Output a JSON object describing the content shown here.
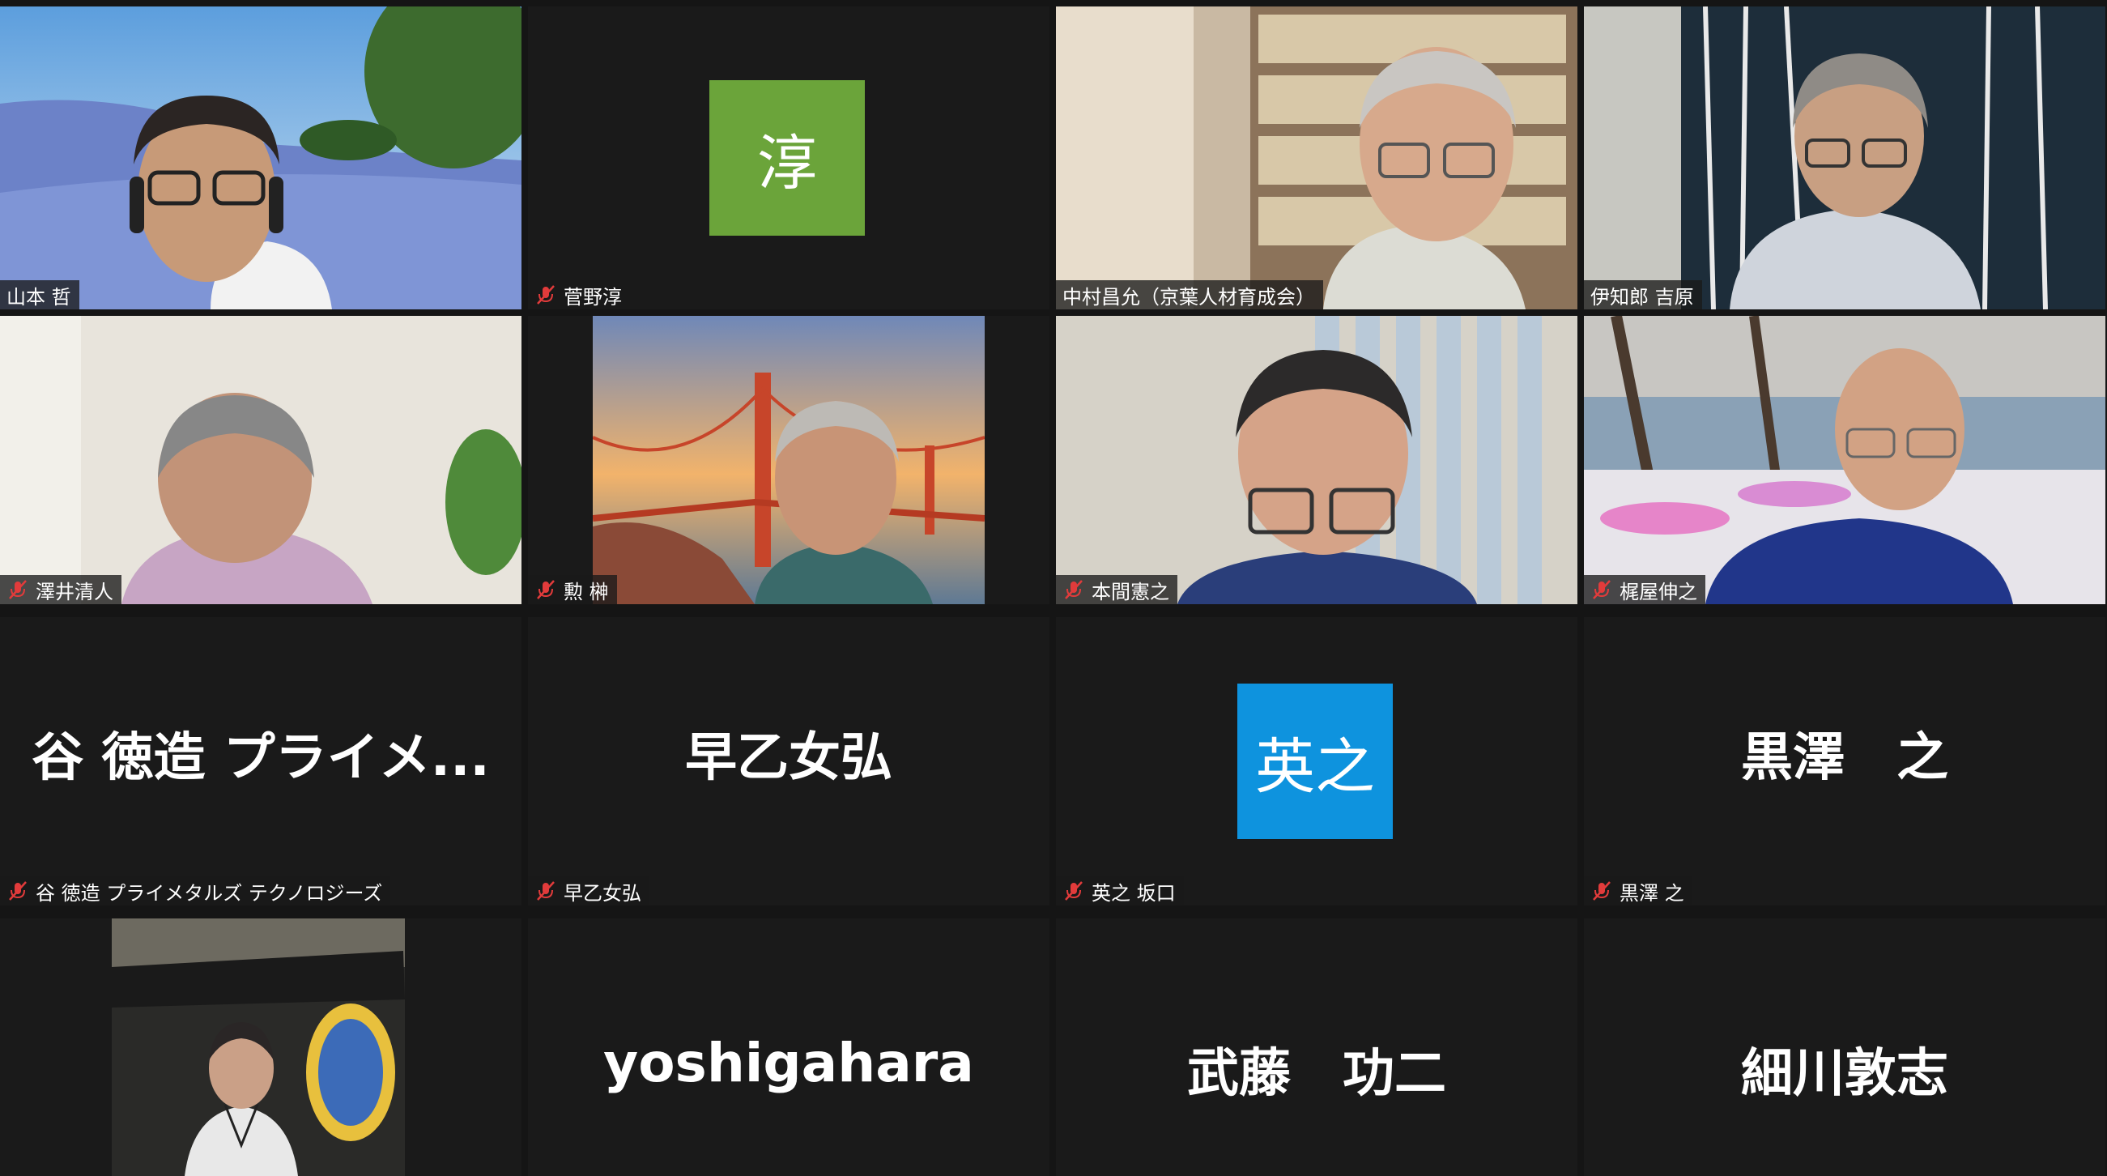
{
  "meeting": {
    "colors": {
      "background": "#151515",
      "tile_background": "#1a1a1a",
      "active_speaker_border": "#d4e85a",
      "muted_icon": "#e23b3b",
      "avatar_green": "#6ba43a",
      "avatar_blue": "#0e93de"
    },
    "participants": [
      {
        "label": "山本 哲",
        "muted": false,
        "active_speaker": true,
        "view": "video"
      },
      {
        "label": "菅野淳",
        "muted": true,
        "view": "avatar",
        "avatar_text": "淳",
        "avatar_color": "#6ba43a"
      },
      {
        "label": "中村昌允（京葉人材育成会）",
        "muted": false,
        "view": "video"
      },
      {
        "label": "伊知郎 吉原",
        "muted": false,
        "view": "video"
      },
      {
        "label": "澤井清人",
        "muted": true,
        "view": "video"
      },
      {
        "label": "勲 榊",
        "muted": true,
        "view": "video"
      },
      {
        "label": "本間憲之",
        "muted": true,
        "view": "video"
      },
      {
        "label": "梶屋伸之",
        "muted": true,
        "view": "video"
      },
      {
        "label": "谷 徳造  プライメタルズ  テクノロジーズ",
        "muted": true,
        "view": "name",
        "display_name": "谷 徳造  プライメ..."
      },
      {
        "label": "早乙女弘",
        "muted": true,
        "view": "name",
        "display_name": "早乙女弘"
      },
      {
        "label": "英之 坂口",
        "muted": true,
        "view": "avatar",
        "avatar_text": "英之",
        "avatar_color": "#0e93de"
      },
      {
        "label": "黒澤  之",
        "muted": true,
        "view": "name",
        "display_name": "黒澤　之"
      },
      {
        "label": "",
        "muted": false,
        "view": "video"
      },
      {
        "label": "",
        "muted": false,
        "view": "name",
        "display_name": "yoshigahara"
      },
      {
        "label": "",
        "muted": false,
        "view": "name",
        "display_name": "武藤　功二"
      },
      {
        "label": "",
        "muted": false,
        "view": "name",
        "display_name": "細川敦志"
      }
    ]
  }
}
